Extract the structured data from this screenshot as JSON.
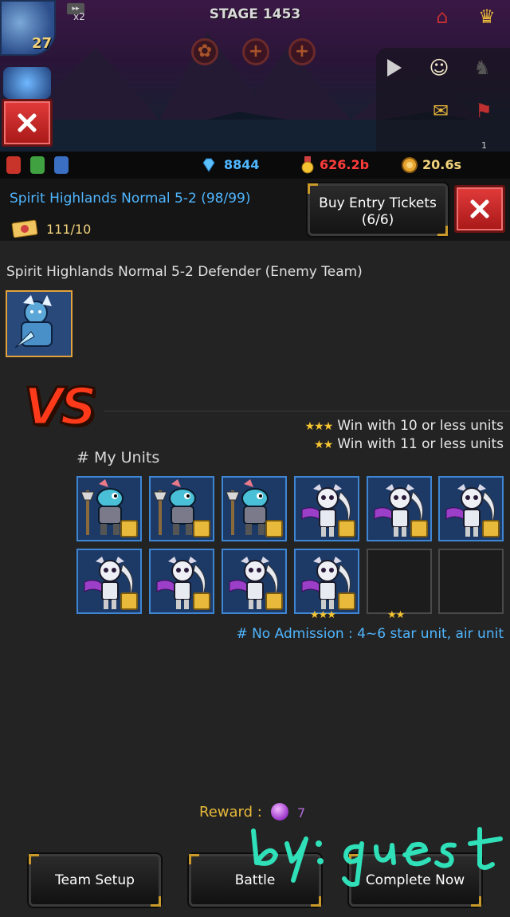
{
  "scene": {
    "stage_title": "STAGE 1453",
    "hero_level": "27",
    "speed_label": "x2",
    "stage_slots": [
      "+",
      "+"
    ],
    "corner_counter": "1"
  },
  "resources": {
    "gems": "8844",
    "gold": "626.2b",
    "timer": "20.6s",
    "colors": {
      "gems": "#4fb6ff",
      "gold": "#ff3c3c",
      "timer": "#f3d37a"
    }
  },
  "dungeon": {
    "title": "Spirit Highlands Normal 5-2 (98/99)",
    "tickets": "111/10",
    "buy_label": "Buy Entry Tickets",
    "buy_count": "(6/6)"
  },
  "enemy": {
    "label": "Spirit Highlands Normal 5-2 Defender (Enemy Team)"
  },
  "vs_text": "VS",
  "conditions": [
    {
      "stars": "★★★",
      "text": "Win with 10 or less units"
    },
    {
      "stars": "★★",
      "text": "Win with 11 or less units"
    }
  ],
  "my_units_label": "# My Units",
  "units": [
    {
      "kind": "lizard-knight",
      "icon": "lizard-knight-icon"
    },
    {
      "kind": "lizard-knight",
      "icon": "lizard-knight-icon"
    },
    {
      "kind": "lizard-knight",
      "icon": "lizard-knight-icon"
    },
    {
      "kind": "skeleton-reaper",
      "icon": "skeleton-reaper-icon"
    },
    {
      "kind": "skeleton-reaper",
      "icon": "skeleton-reaper-icon"
    },
    {
      "kind": "skeleton-reaper",
      "icon": "skeleton-reaper-icon"
    },
    {
      "kind": "skeleton-reaper",
      "icon": "skeleton-reaper-icon"
    },
    {
      "kind": "skeleton-reaper",
      "icon": "skeleton-reaper-icon"
    },
    {
      "kind": "skeleton-reaper",
      "icon": "skeleton-reaper-icon"
    },
    {
      "kind": "skeleton-reaper",
      "icon": "skeleton-reaper-icon"
    },
    {
      "kind": "empty"
    },
    {
      "kind": "empty"
    }
  ],
  "slot_star_markers": {
    "slot_10": "★★★",
    "slot_11": "★★"
  },
  "no_admission": "# No Admission : 4~6 star unit, air unit",
  "reward": {
    "label": "Reward :",
    "count": "7"
  },
  "buttons": {
    "team_setup": "Team Setup",
    "battle": "Battle",
    "complete_now": "Complete Now"
  },
  "watermark": "by: guest"
}
